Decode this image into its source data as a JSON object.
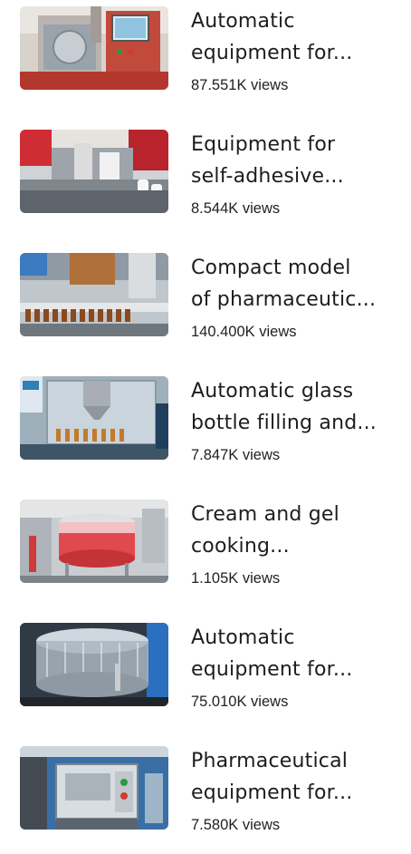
{
  "videos": [
    {
      "title_line1": "Automatic",
      "title_line2": "equipment for...",
      "views": "87.551K views",
      "thumbnail": "capsule-filling-machine"
    },
    {
      "title_line1": "Equipment for",
      "title_line2": "self-adhesive...",
      "views": "8.544K views",
      "thumbnail": "labeling-machine"
    },
    {
      "title_line1": "Compact model",
      "title_line2": "of pharmaceutic...",
      "views": "140.400K views",
      "thumbnail": "vial-filling-line"
    },
    {
      "title_line1": "Automatic glass",
      "title_line2": "bottle filling and...",
      "views": "7.847K views",
      "thumbnail": "bottle-filling-machine"
    },
    {
      "title_line1": "Cream and gel",
      "title_line2": "cooking...",
      "views": "1.105K views",
      "thumbnail": "cream-cooking-tank"
    },
    {
      "title_line1": "Automatic",
      "title_line2": "equipment for...",
      "views": "75.010K views",
      "thumbnail": "glass-drum-machine"
    },
    {
      "title_line1": "Pharmaceutical",
      "title_line2": "equipment for...",
      "views": "7.580K views",
      "thumbnail": "tablet-machine"
    }
  ]
}
